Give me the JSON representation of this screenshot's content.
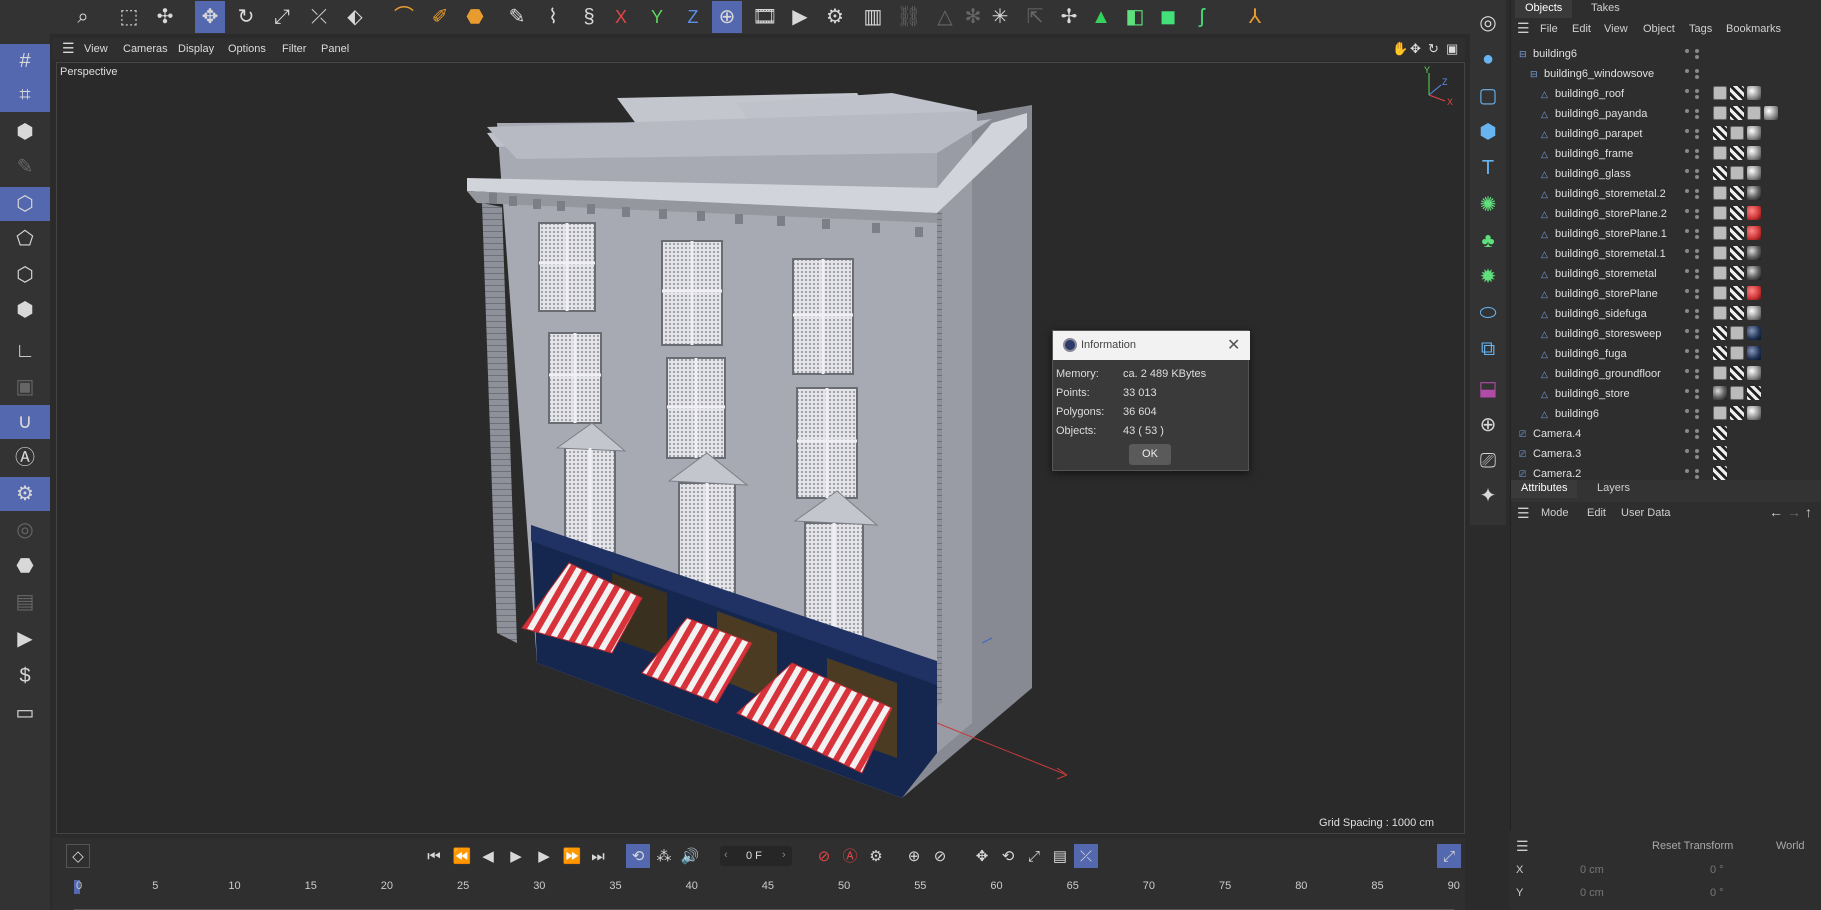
{
  "toolbar_icons": [
    "search-icon",
    "live-selection-icon",
    "transform-icon",
    "move-icon",
    "rotate-icon",
    "scale-icon",
    "add-point-icon",
    "polygon-pen-icon",
    "spline-pen-icon",
    "sketch-icon",
    "brush-icon",
    "paint-icon",
    "x-axis-icon",
    "y-axis-icon",
    "z-axis-icon",
    "coordinate-system-icon",
    "render-view-icon",
    "render-picture-viewer-icon",
    "edit-render-settings-icon",
    "render-queue-icon"
  ],
  "axis_labels": {
    "x": "X",
    "y": "Y",
    "z": "Z"
  },
  "viewport": {
    "menu": [
      "View",
      "Cameras",
      "Display",
      "Options",
      "Filter",
      "Panel"
    ],
    "label": "Perspective",
    "grid_spacing": "Grid Spacing : 1000 cm"
  },
  "dialog": {
    "title": "Information",
    "rows": [
      {
        "label": "Memory:",
        "value": "ca. 2 489 KBytes"
      },
      {
        "label": "Points:",
        "value": "33 013"
      },
      {
        "label": "Polygons:",
        "value": "36 604"
      },
      {
        "label": "Objects:",
        "value": "43 ( 53 )"
      }
    ],
    "ok": "OK"
  },
  "objects_panel": {
    "tabs": [
      "Objects",
      "Takes"
    ],
    "menu": [
      "File",
      "Edit",
      "View",
      "Object",
      "Tags",
      "Bookmarks"
    ],
    "items": [
      {
        "name": "building6",
        "level": 0,
        "tags": []
      },
      {
        "name": "building6_windowsove",
        "level": 1,
        "tags": []
      },
      {
        "name": "building6_roof",
        "level": 2,
        "tags": [
          "t1",
          "t2",
          "t3"
        ]
      },
      {
        "name": "building6_payanda",
        "level": 2,
        "tags": [
          "t1",
          "t2",
          "t1",
          "t3"
        ]
      },
      {
        "name": "building6_parapet",
        "level": 2,
        "tags": [
          "t2",
          "t1",
          "t3"
        ]
      },
      {
        "name": "building6_frame",
        "level": 2,
        "tags": [
          "t1",
          "t2",
          "t3"
        ]
      },
      {
        "name": "building6_glass",
        "level": 2,
        "tags": [
          "t2",
          "t1",
          "t3"
        ]
      },
      {
        "name": "building6_storemetal.2",
        "level": 2,
        "tags": [
          "t1",
          "t2",
          "t6"
        ]
      },
      {
        "name": "building6_storePlane.2",
        "level": 2,
        "tags": [
          "t1",
          "t2",
          "t4"
        ]
      },
      {
        "name": "building6_storePlane.1",
        "level": 2,
        "tags": [
          "t1",
          "t2",
          "t4"
        ]
      },
      {
        "name": "building6_storemetal.1",
        "level": 2,
        "tags": [
          "t1",
          "t2",
          "t6"
        ]
      },
      {
        "name": "building6_storemetal",
        "level": 2,
        "tags": [
          "t1",
          "t2",
          "t6"
        ]
      },
      {
        "name": "building6_storePlane",
        "level": 2,
        "tags": [
          "t1",
          "t2",
          "t4"
        ]
      },
      {
        "name": "building6_sidefuga",
        "level": 2,
        "tags": [
          "t1",
          "t2",
          "t3"
        ]
      },
      {
        "name": "building6_storesweep",
        "level": 2,
        "tags": [
          "t2",
          "t1",
          "t5"
        ]
      },
      {
        "name": "building6_fuga",
        "level": 2,
        "tags": [
          "t2",
          "t1",
          "t5"
        ]
      },
      {
        "name": "building6_groundfloor",
        "level": 2,
        "tags": [
          "t1",
          "t2",
          "t3"
        ]
      },
      {
        "name": "building6_store",
        "level": 2,
        "tags": [
          "t6",
          "t1",
          "t2"
        ]
      },
      {
        "name": "building6",
        "level": 2,
        "tags": [
          "t1",
          "t2",
          "t3"
        ]
      },
      {
        "name": "Camera.4",
        "level": 0,
        "tags": [
          "t2"
        ]
      },
      {
        "name": "Camera.3",
        "level": 0,
        "tags": [
          "t2"
        ]
      },
      {
        "name": "Camera.2",
        "level": 0,
        "tags": [
          "t2"
        ]
      }
    ]
  },
  "attributes_panel": {
    "tabs": [
      "Attributes",
      "Layers"
    ],
    "menu": [
      "Mode",
      "Edit",
      "User Data"
    ]
  },
  "coordinates": {
    "reset": "Reset Transform",
    "space": "World",
    "rows": [
      {
        "axis": "X",
        "pos": "0 cm",
        "rot": "0 °"
      },
      {
        "axis": "Y",
        "pos": "0 cm",
        "rot": "0 °"
      }
    ]
  },
  "timeline": {
    "frame": "0 F",
    "ticks": [
      "0",
      "5",
      "10",
      "15",
      "20",
      "25",
      "30",
      "35",
      "40",
      "45",
      "50",
      "55",
      "60",
      "65",
      "70",
      "75",
      "80",
      "85",
      "90"
    ]
  },
  "colors": {
    "accent": "#5468b0",
    "awning_red": "#d8323a",
    "store_blue": "#16274f",
    "wall": "#a7a9b3"
  }
}
